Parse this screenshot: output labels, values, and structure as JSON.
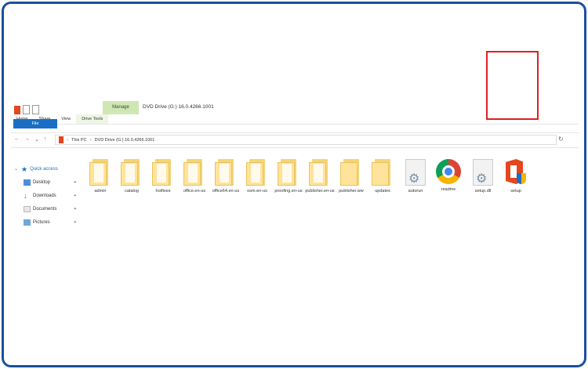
{
  "ribbon": {
    "context_tab": "Manage",
    "window_title": "DVD Drive (G:) 16.0.4266.1001",
    "tabs": [
      "File",
      "Home",
      "Share",
      "View",
      "Drive Tools"
    ]
  },
  "address": {
    "crumbs": [
      "This PC",
      "DVD Drive (G:) 16.0.4266.1001"
    ]
  },
  "sidebar": {
    "items": [
      {
        "label": "Quick access",
        "icon": "star-icon"
      },
      {
        "label": "Desktop",
        "icon": "desktop-icon"
      },
      {
        "label": "Downloads",
        "icon": "download-icon"
      },
      {
        "label": "Documents",
        "icon": "documents-icon"
      },
      {
        "label": "Pictures",
        "icon": "pictures-icon"
      }
    ]
  },
  "files": [
    {
      "name": "admin",
      "kind": "folder"
    },
    {
      "name": "catalog",
      "kind": "folder"
    },
    {
      "name": "hotfixes",
      "kind": "folder"
    },
    {
      "name": "office.en-us",
      "kind": "folder"
    },
    {
      "name": "office64.en-us",
      "kind": "folder"
    },
    {
      "name": "osm.en-us",
      "kind": "folder"
    },
    {
      "name": "proofing.en-us",
      "kind": "folder"
    },
    {
      "name": "publisher.en-us",
      "kind": "folder"
    },
    {
      "name": "publisher.ww",
      "kind": "folder"
    },
    {
      "name": "updates",
      "kind": "folder"
    },
    {
      "name": "autorun",
      "kind": "settings-file"
    },
    {
      "name": "readme",
      "kind": "chrome"
    },
    {
      "name": "setup.dll",
      "kind": "settings-file"
    },
    {
      "name": "setup",
      "kind": "office-setup"
    }
  ],
  "colors": {
    "frame_border": "#1b4f9c",
    "highlight": "#e02020",
    "file_tab": "#1a6fc4"
  }
}
